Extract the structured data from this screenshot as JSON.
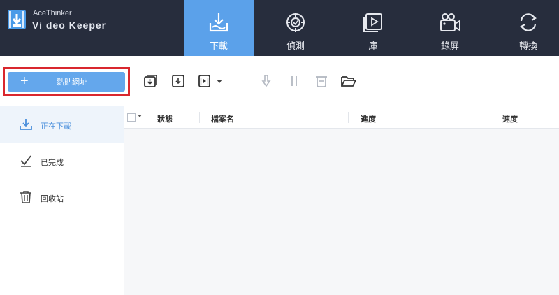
{
  "app": {
    "brand_line1": "AceThinker",
    "brand_line2": "Vi deo  Keeper"
  },
  "nav": {
    "tabs": [
      {
        "label": "下載",
        "icon": "download-tray-icon",
        "active": true
      },
      {
        "label": "偵測",
        "icon": "target-detect-icon",
        "active": false
      },
      {
        "label": "庫",
        "icon": "video-library-icon",
        "active": false
      },
      {
        "label": "錄屏",
        "icon": "camera-record-icon",
        "active": false
      },
      {
        "label": "轉換",
        "icon": "convert-cycle-icon",
        "active": false
      }
    ]
  },
  "toolbar": {
    "paste_url_label": "黏貼網址",
    "icons": [
      "download-queue-icon",
      "download-icon",
      "video-dropdown-icon",
      "start-download-icon",
      "pause-icon",
      "delete-icon",
      "open-folder-icon"
    ]
  },
  "sidebar": {
    "items": [
      {
        "label": "正在下載",
        "icon": "downloading-icon",
        "active": true
      },
      {
        "label": "已完成",
        "icon": "completed-check-icon",
        "active": false
      },
      {
        "label": "回收站",
        "icon": "recycle-bin-icon",
        "active": false
      }
    ]
  },
  "table": {
    "columns": [
      "狀態",
      "檔案名",
      "進度",
      "速度"
    ]
  },
  "colors": {
    "topbar": "#272d3d",
    "accent": "#5ba1ea",
    "highlight_frame": "#d9272e"
  }
}
